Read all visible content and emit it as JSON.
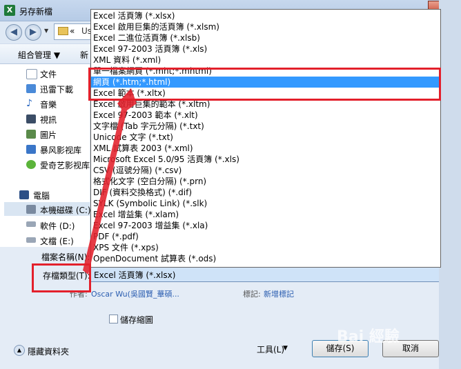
{
  "window": {
    "title": "另存新檔",
    "app_icon": "X",
    "close": "✕"
  },
  "nav": {
    "back": "◀",
    "forward": "▶",
    "history": "▼",
    "breadcrumb_sep": "«",
    "breadcrumb_text": "Us"
  },
  "toolbar": {
    "organize": "組合管理 ▼",
    "new_folder": "新"
  },
  "sidebar": {
    "items": [
      "文件",
      "迅雷下載",
      "音樂",
      "視訊",
      "圖片",
      "暴风影视库",
      "愛奇艺影视库"
    ],
    "computer": "電腦",
    "drives": [
      "本機磁碟 (C:)",
      "軟件 (D:)",
      "文檔 (E:)"
    ]
  },
  "form": {
    "filename_label": "檔案名稱(N):",
    "filetype_label": "存檔類型(T):",
    "filetype_value": "Excel 活頁簿 (*.xlsx)",
    "author_label": "作者:",
    "author_value": "Oscar Wu(吳國賢_華碩...",
    "tags_label": "標記:",
    "tags_value": "新增標記",
    "thumbnail_label": "儲存縮圖"
  },
  "footer": {
    "hide_folders": "隱藏資料夾",
    "tools": "工具(L)",
    "save": "儲存(S)",
    "cancel": "取消"
  },
  "dropdown": {
    "selected_index": 6,
    "options": [
      "Excel 活頁簿 (*.xlsx)",
      "Excel 啟用巨集的活頁簿 (*.xlsm)",
      "Excel 二進位活頁簿 (*.xlsb)",
      "Excel 97-2003 活頁簿 (*.xls)",
      "XML 資料 (*.xml)",
      "單一檔案網頁 (*.mht;*.mhtml)",
      "網頁 (*.htm;*.html)",
      "Excel 範本 (*.xltx)",
      "Excel 啟用巨集的範本 (*.xltm)",
      "Excel 97-2003 範本 (*.xlt)",
      "文字檔 (Tab 字元分隔) (*.txt)",
      "Unicode 文字 (*.txt)",
      "XML 試算表 2003 (*.xml)",
      "Microsoft Excel 5.0/95 活頁簿 (*.xls)",
      "CSV (逗號分隔) (*.csv)",
      "格式化文字 (空白分隔) (*.prn)",
      "DIF (資料交換格式) (*.dif)",
      "SYLK (Symbolic Link) (*.slk)",
      "Excel 增益集 (*.xlam)",
      "Excel 97-2003 增益集 (*.xla)",
      "PDF (*.pdf)",
      "XPS 文件 (*.xps)",
      "OpenDocument 試算表 (*.ods)"
    ]
  },
  "watermark": "Bai 經驗",
  "colors": {
    "highlight": "#e3202b",
    "selection": "#3399ff"
  }
}
